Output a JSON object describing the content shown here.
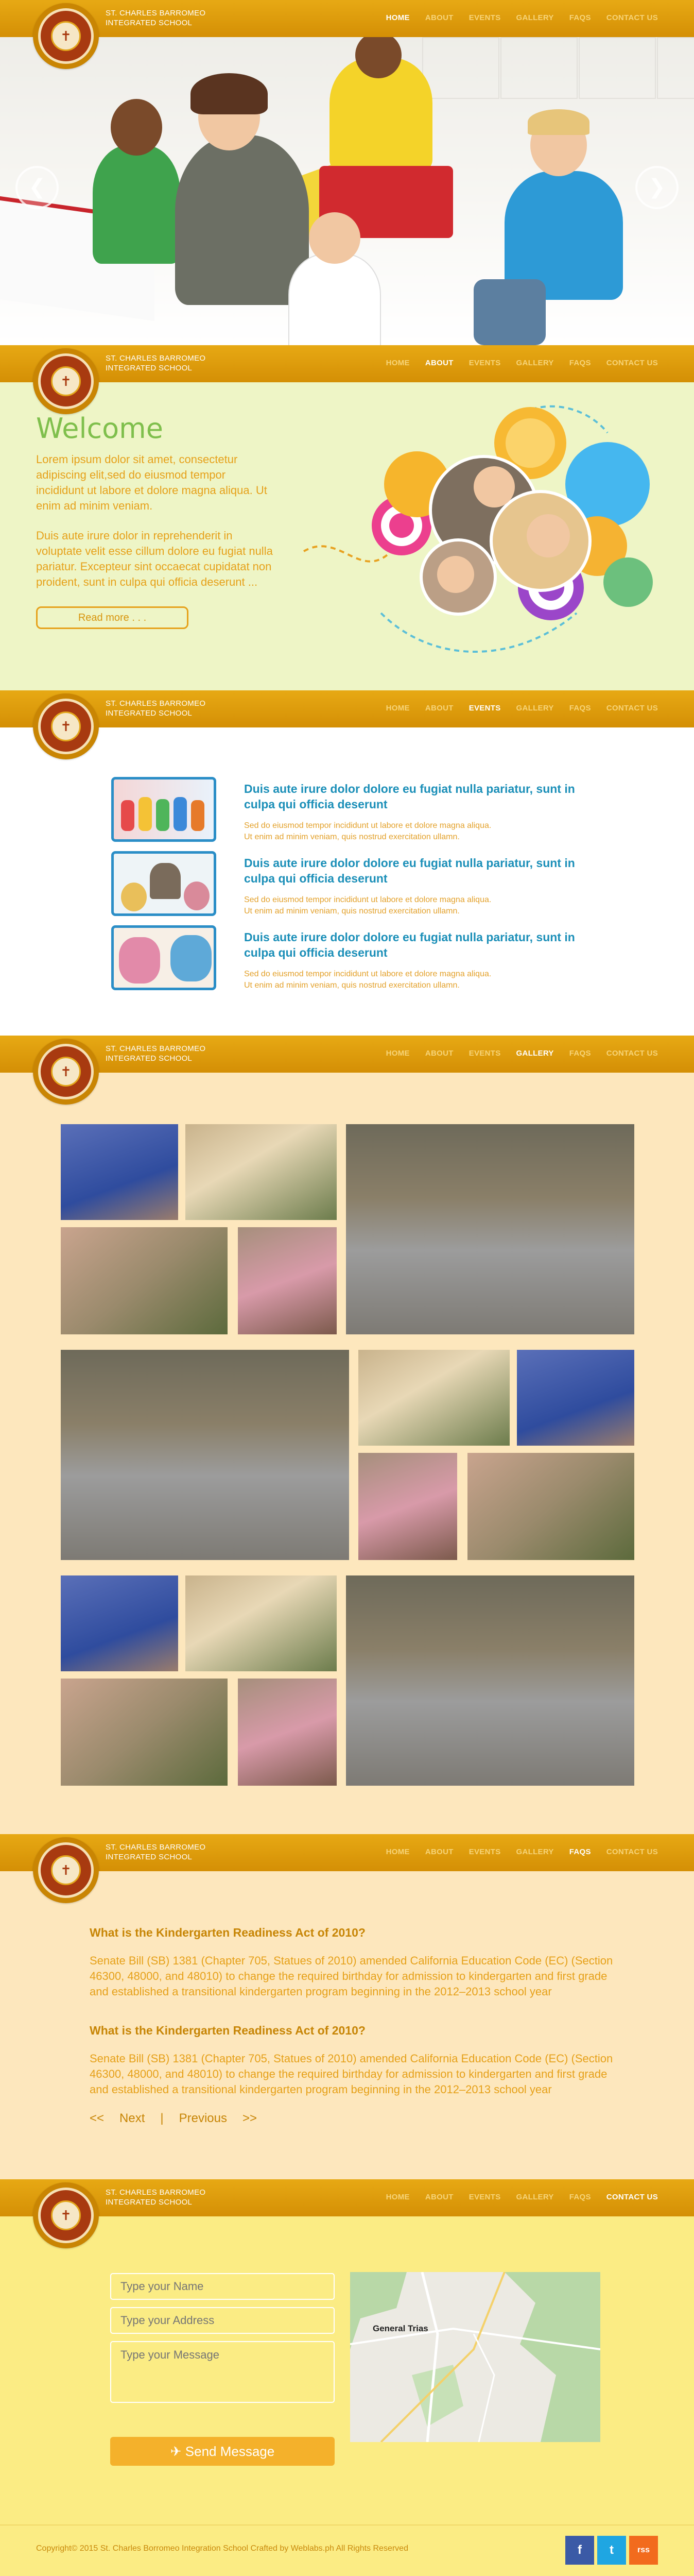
{
  "school": {
    "line1": "ST. CHARLES BARROMEO",
    "line2": "INTEGRATED SCHOOL"
  },
  "nav": [
    "HOME",
    "ABOUT",
    "EVENTS",
    "GALLERY",
    "FAQS",
    "CONTACT US"
  ],
  "hero": {
    "prev_icon": "arrow-left-icon",
    "next_icon": "arrow-right-icon"
  },
  "about": {
    "title": "Welcome",
    "para1": "Lorem ipsum dolor sit amet, consectetur adipiscing elit,sed do eiusmod tempor incididunt ut labore et dolore magna aliqua. Ut enim ad minim veniam.",
    "para2": "Duis aute irure dolor in reprehenderit in voluptate velit  esse cillum dolore eu fugiat nulla pariatur. Excepteur sint occaecat cupidatat non proident, sunt in culpa qui officia deserunt ...",
    "button": "Read more . . ."
  },
  "events": [
    {
      "title": "Duis aute irure dolor dolore eu fugiat nulla pariatur, sunt in culpa qui officia deserunt",
      "desc1": "Sed do eiusmod tempor incididunt ut labore et dolore magna aliqua.",
      "desc2": "Ut enim ad minim veniam, quis nostrud exercitation ullamn."
    },
    {
      "title": "Duis aute irure dolor dolore eu fugiat nulla pariatur, sunt in culpa qui officia deserunt",
      "desc1": "Sed do eiusmod tempor incididunt ut labore et dolore magna aliqua.",
      "desc2": "Ut enim ad minim veniam, quis nostrud exercitation ullamn."
    },
    {
      "title": "Duis aute irure dolor dolore eu fugiat nulla pariatur, sunt in culpa qui officia deserunt",
      "desc1": "Sed do eiusmod tempor incididunt ut labore et dolore magna aliqua.",
      "desc2": "Ut enim ad minim veniam, quis nostrud exercitation ullamn."
    }
  ],
  "faqs": [
    {
      "q": "What is the Kindergarten Readiness Act of 2010?",
      "a": "Senate Bill (SB) 1381 (Chapter 705, Statues of 2010) amended California Education Code (EC) (Section 46300, 48000, and 48010) to change the required birthday for admission to kindergarten and first grade and established a transitional kindergarten program beginning in the 2012–2013 school year"
    },
    {
      "q": "What is the Kindergarten Readiness Act of 2010?",
      "a": "Senate Bill (SB) 1381 (Chapter 705, Statues of 2010) amended California Education Code (EC) (Section 46300, 48000, and 48010) to change the required birthday for admission to kindergarten and first grade and established a transitional kindergarten program beginning in the 2012–2013 school year"
    }
  ],
  "pager": {
    "prev_arrows": "<<",
    "next": "Next",
    "sep": "|",
    "previous": "Previous",
    "next_arrows": ">>"
  },
  "contact": {
    "name_placeholder": "Type your Name",
    "address_placeholder": "Type your Address",
    "message_placeholder": "Type your Message",
    "send": "Send Message",
    "map_label": "General Trias"
  },
  "footer": {
    "copyright": "Copyright© 2015 St. Charles Borromeo Integration School Crafted by Weblabs.ph All Rights Reserved",
    "social": [
      "f",
      "t",
      "rss"
    ]
  },
  "colors": {
    "bar": "#e1a00f",
    "about_bg": "#eef5c6",
    "gallery_bg": "#fde7bd",
    "contact_bg": "#fbec84",
    "event_title": "#1b8fb8"
  }
}
